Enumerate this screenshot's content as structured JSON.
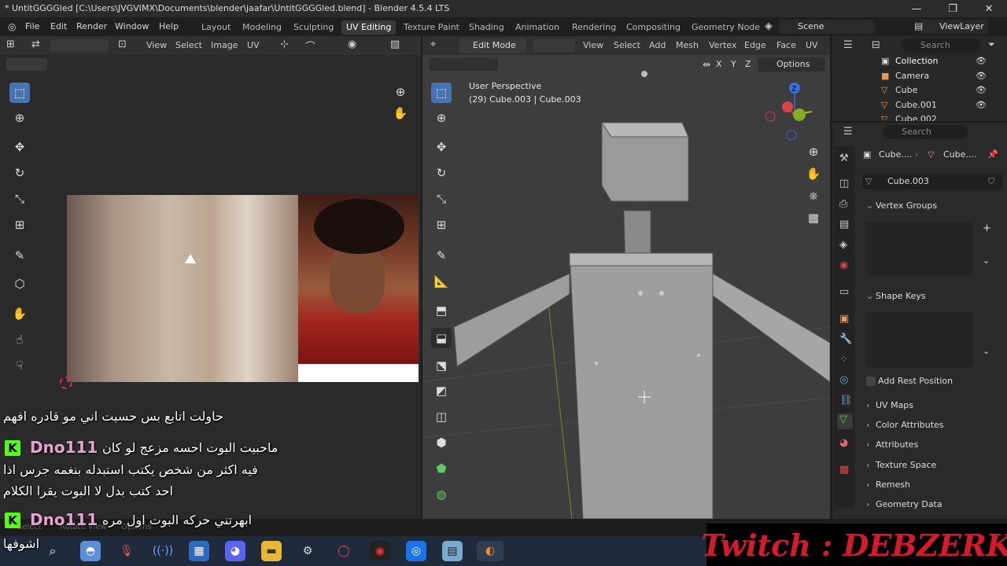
{
  "window": {
    "title": "* UntitGGGGled [C:\\Users\\JVGVIMX\\Documents\\blender\\jaafar\\UntitGGGGled.blend] - Blender 4.5.4 LTS",
    "minimize": "—",
    "maximize": "❐",
    "close": "✕"
  },
  "menubar": {
    "menus": [
      "File",
      "Edit",
      "Render",
      "Window",
      "Help"
    ],
    "workspaces": [
      "Layout",
      "Modeling",
      "Sculpting",
      "UV Editing",
      "Texture Paint",
      "Shading",
      "Animation",
      "Rendering",
      "Compositing",
      "Geometry Node"
    ],
    "active_workspace": "UV Editing",
    "scene": "Scene",
    "view_layer": "ViewLayer"
  },
  "uv_editor": {
    "header_menus": [
      "View",
      "Select",
      "Image",
      "UV"
    ]
  },
  "viewport": {
    "mode": "Edit Mode",
    "header_menus": [
      "View",
      "Select",
      "Add",
      "Mesh",
      "Vertex",
      "Edge",
      "Face",
      "UV"
    ],
    "overlay_line1": "User Perspective",
    "overlay_line2": "(29) Cube.003 | Cube.003",
    "axes_lock": [
      "X",
      "Y",
      "Z"
    ],
    "options_label": "Options",
    "gizmo": {
      "x": "X",
      "y": "Y",
      "z": "Z"
    }
  },
  "outliner": {
    "search_placeholder": "Search",
    "collection": "Collection",
    "items": [
      "Camera",
      "Cube",
      "Cube.001",
      "Cube.002"
    ]
  },
  "properties": {
    "search_placeholder": "Search",
    "breadcrumb_object": "Cube....",
    "breadcrumb_mesh": "Cube....",
    "mesh_name": "Cube.003",
    "sections": {
      "vertex_groups": "Vertex Groups",
      "shape_keys": "Shape Keys",
      "add_rest_position": "Add Rest Position",
      "uv_maps": "UV Maps",
      "color_attributes": "Color Attributes",
      "attributes": "Attributes",
      "texture_space": "Texture Space",
      "remesh": "Remesh",
      "geometry_data": "Geometry Data"
    }
  },
  "chat": {
    "line1": "حاولت اتابع بس حسيت اني مو قادره افهم",
    "msg1_user": "Dno111",
    "msg1_lines": [
      "ماحبيت البوت احسه مزعج لو كان",
      "فيه اكثر من شخص يكتب استبدله بنغمه جرس اذا",
      "احد كتب بدل لا البوت يقرا الكلام"
    ],
    "msg2_user": "Dno111",
    "msg2_line1": "ابهرتني حركه البوت اول مره",
    "msg2_line2": "اشوفها",
    "badge": "K"
  },
  "status_bar": {
    "select": "Select",
    "rotate_view": "Rotate View",
    "options": "Options"
  },
  "overlay_brand": "Twitch : DEBZERK",
  "colors": {
    "accent": "#4772b3",
    "kick_green": "#53fc18",
    "twitch_red": "#d8192c",
    "username_pink": "#e9a0d4"
  }
}
